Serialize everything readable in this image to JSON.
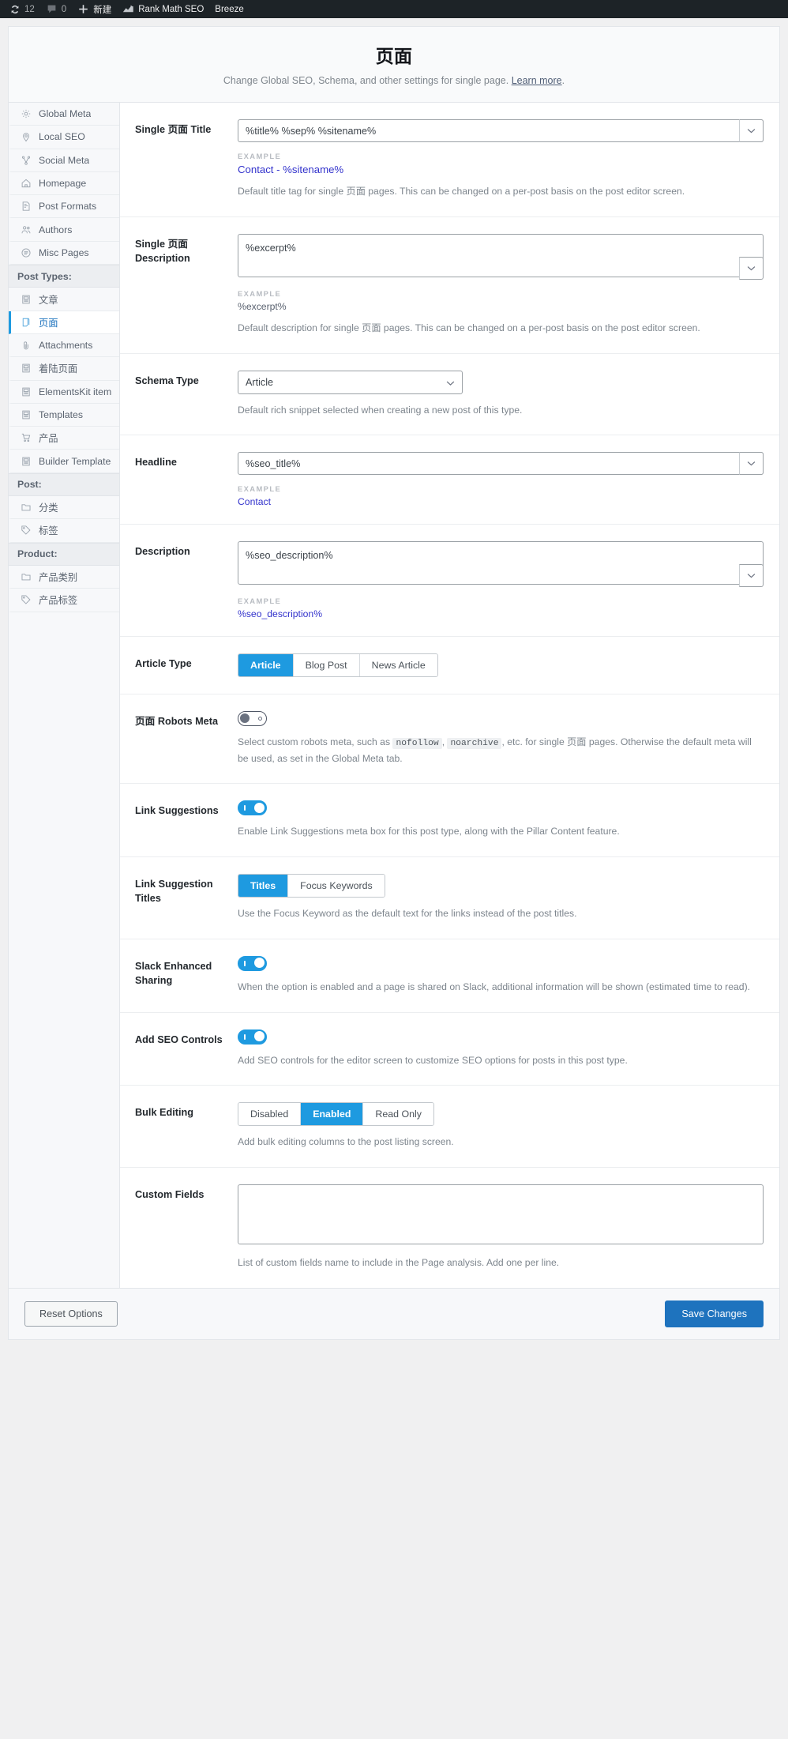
{
  "adminbar": {
    "items": [
      {
        "icon": "wordpress-updates-icon",
        "label": "12",
        "name": "updates-count"
      },
      {
        "icon": "comment-bubble-icon",
        "label": "0",
        "name": "comments-count"
      },
      {
        "icon": "plus-icon",
        "label": "新建",
        "name": "new-content"
      },
      {
        "icon": "rank-math-icon",
        "label": "Rank Math SEO",
        "name": "rank-math-menu"
      },
      {
        "icon": "",
        "label": "Breeze",
        "name": "breeze-menu"
      }
    ]
  },
  "header": {
    "title": "页面",
    "subtitle": "Change Global SEO, Schema, and other settings for single page.",
    "learn_more": "Learn more"
  },
  "sidebar": {
    "items": [
      {
        "label": "Global Meta",
        "icon": "gear-icon",
        "type": "item",
        "active": false
      },
      {
        "label": "Local SEO",
        "icon": "map-pin-icon",
        "type": "item",
        "active": false
      },
      {
        "label": "Social Meta",
        "icon": "share-nodes-icon",
        "type": "item",
        "active": false
      },
      {
        "label": "Homepage",
        "icon": "home-icon",
        "type": "item",
        "active": false
      },
      {
        "label": "Post Formats",
        "icon": "document-icon",
        "type": "item",
        "active": false
      },
      {
        "label": "Authors",
        "icon": "users-icon",
        "type": "item",
        "active": false
      },
      {
        "label": "Misc Pages",
        "icon": "list-circle-icon",
        "type": "item",
        "active": false
      },
      {
        "label": "Post Types:",
        "icon": "",
        "type": "group",
        "active": false
      },
      {
        "label": "文章",
        "icon": "post-icon",
        "type": "item",
        "active": false
      },
      {
        "label": "页面",
        "icon": "page-icon",
        "type": "item",
        "active": true
      },
      {
        "label": "Attachments",
        "icon": "paperclip-icon",
        "type": "item",
        "active": false
      },
      {
        "label": "着陆页面",
        "icon": "post-icon",
        "type": "item",
        "active": false
      },
      {
        "label": "ElementsKit items",
        "icon": "post-icon",
        "type": "item",
        "active": false
      },
      {
        "label": "Templates",
        "icon": "post-icon",
        "type": "item",
        "active": false
      },
      {
        "label": "产品",
        "icon": "cart-icon",
        "type": "item",
        "active": false
      },
      {
        "label": "Builder Templates",
        "icon": "post-icon",
        "type": "item",
        "active": false
      },
      {
        "label": "Post:",
        "icon": "",
        "type": "group",
        "active": false
      },
      {
        "label": "分类",
        "icon": "folder-icon",
        "type": "item",
        "active": false
      },
      {
        "label": "标签",
        "icon": "tag-icon",
        "type": "item",
        "active": false
      },
      {
        "label": "Product:",
        "icon": "",
        "type": "group",
        "active": false
      },
      {
        "label": "产品类别",
        "icon": "folder-icon",
        "type": "item",
        "active": false
      },
      {
        "label": "产品标签",
        "icon": "tag-icon",
        "type": "item",
        "active": false
      }
    ]
  },
  "example_label": "EXAMPLE",
  "fields": {
    "single_title": {
      "label": "Single 页面 Title",
      "value": "%title% %sep% %sitename%",
      "example": "Contact - %sitename%",
      "help": "Default title tag for single 页面 pages. This can be changed on a per-post basis on the post editor screen."
    },
    "single_description": {
      "label": "Single 页面 Description",
      "value": "%excerpt%",
      "example": "%excerpt%",
      "help": "Default description for single 页面 pages. This can be changed on a per-post basis on the post editor screen."
    },
    "schema_type": {
      "label": "Schema Type",
      "value": "Article",
      "options": [
        "Article"
      ],
      "help": "Default rich snippet selected when creating a new post of this type."
    },
    "headline": {
      "label": "Headline",
      "value": "%seo_title%",
      "example": "Contact"
    },
    "description": {
      "label": "Description",
      "value": "%seo_description%",
      "example": "%seo_description%"
    },
    "article_type": {
      "label": "Article Type",
      "options": [
        "Article",
        "Blog Post",
        "News Article"
      ],
      "selected": "Article"
    },
    "robots_meta": {
      "label": "页面 Robots Meta",
      "state": "off",
      "help_pre": "Select custom robots meta, such as ",
      "code1": "nofollow",
      "help_mid": ", ",
      "code2": "noarchive",
      "help_post": ", etc. for single 页面 pages. Otherwise the default meta will be used, as set in the Global Meta tab."
    },
    "link_suggestions": {
      "label": "Link Suggestions",
      "state": "on",
      "help": "Enable Link Suggestions meta box for this post type, along with the Pillar Content feature."
    },
    "link_suggestion_titles": {
      "label": "Link Suggestion Titles",
      "options": [
        "Titles",
        "Focus Keywords"
      ],
      "selected": "Titles",
      "help": "Use the Focus Keyword as the default text for the links instead of the post titles."
    },
    "slack_sharing": {
      "label": "Slack Enhanced Sharing",
      "state": "on",
      "help": "When the option is enabled and a page is shared on Slack, additional information will be shown (estimated time to read)."
    },
    "seo_controls": {
      "label": "Add SEO Controls",
      "state": "on",
      "help": "Add SEO controls for the editor screen to customize SEO options for posts in this post type."
    },
    "bulk_editing": {
      "label": "Bulk Editing",
      "options": [
        "Disabled",
        "Enabled",
        "Read Only"
      ],
      "selected": "Enabled",
      "help": "Add bulk editing columns to the post listing screen."
    },
    "custom_fields": {
      "label": "Custom Fields",
      "value": "",
      "placeholder": "",
      "help": "List of custom fields name to include in the Page analysis. Add one per line."
    }
  },
  "footer": {
    "reset_label": "Reset Options",
    "save_label": "Save Changes"
  },
  "colors": {
    "accent": "#1e9ae0",
    "primary": "#1e73be",
    "link": "#3333cc",
    "adminbar": "#1d2327"
  }
}
